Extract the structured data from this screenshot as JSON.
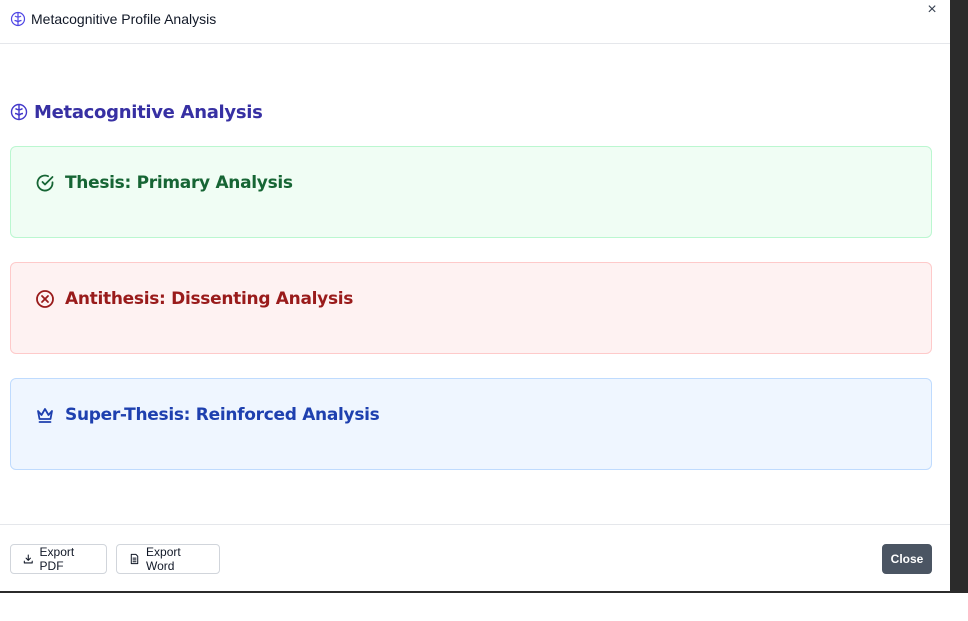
{
  "dialog": {
    "title": "Metacognitive Profile Analysis",
    "close_icon": "×"
  },
  "section": {
    "title": "Metacognitive Analysis"
  },
  "cards": [
    {
      "title": "Thesis: Primary Analysis",
      "icon": "check-circle-icon",
      "color": "#166534"
    },
    {
      "title": "Antithesis: Dissenting Analysis",
      "icon": "x-circle-icon",
      "color": "#991b1b"
    },
    {
      "title": "Super-Thesis: Reinforced Analysis",
      "icon": "crown-icon",
      "color": "#1e40af"
    }
  ],
  "footer": {
    "export_pdf": "Export PDF",
    "export_word": "Export Word",
    "close": "Close"
  }
}
